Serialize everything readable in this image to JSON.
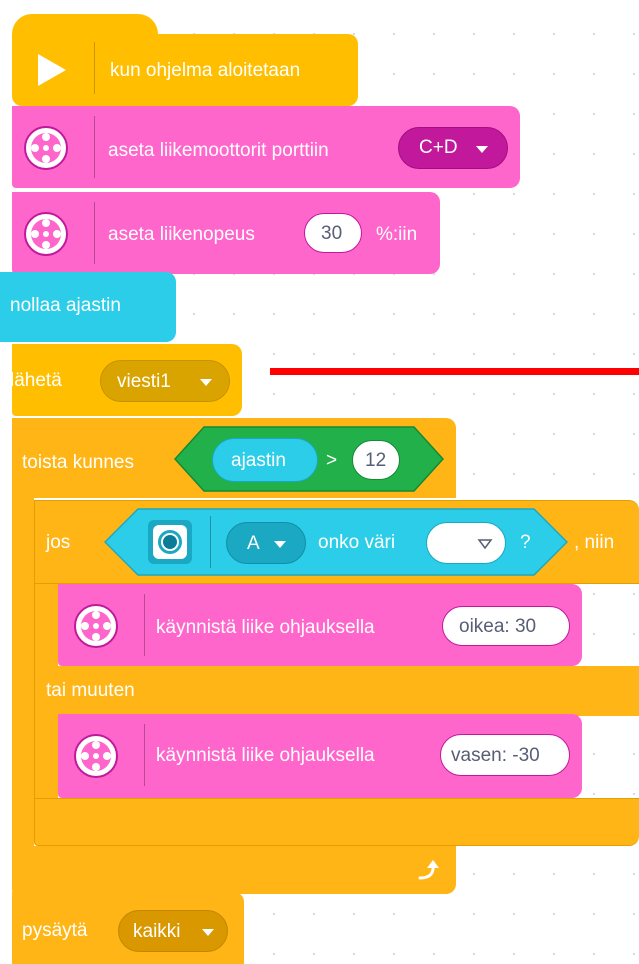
{
  "blocks": {
    "when_program_starts": {
      "label": "kun ohjelma aloitetaan"
    },
    "set_motors_ports": {
      "label": "aseta liikemoottorit porttiin",
      "value": "C+D"
    },
    "set_speed": {
      "label": "aseta liikenopeus",
      "value": "30",
      "suffix": "%:iin"
    },
    "reset_timer": {
      "label": "nollaa ajastin"
    },
    "broadcast": {
      "label": "lähetä",
      "value": "viesti1"
    },
    "repeat_until": {
      "label": "toista kunnes",
      "condition": {
        "left": "ajastin",
        "operator": ">",
        "right": "12"
      }
    },
    "if_else": {
      "if_label": "jos",
      "then_label": ", niin",
      "else_label": "tai muuten",
      "sensor": {
        "port": "A",
        "question": "onko väri",
        "value": "",
        "qmark": "?"
      },
      "then_action": {
        "label": "käynnistä liike ohjauksella",
        "value": "oikea: 30"
      },
      "else_action": {
        "label": "käynnistä liike ohjauksella",
        "value": "vasen: -30"
      }
    },
    "stop": {
      "label": "pysäytä",
      "value": "kaikki"
    }
  },
  "colors": {
    "events": "#ffbf00",
    "control": "#ffb515",
    "motors": "#ff66cc",
    "motors_menu": "#c2189c",
    "sensors": "#2ccde8",
    "operators": "#22b04a",
    "annotation_line": "#ff0000"
  },
  "icons": [
    "play-icon",
    "motor-icon",
    "color-sensor-icon",
    "dropdown-arrow-icon",
    "loop-arrow-icon"
  ]
}
